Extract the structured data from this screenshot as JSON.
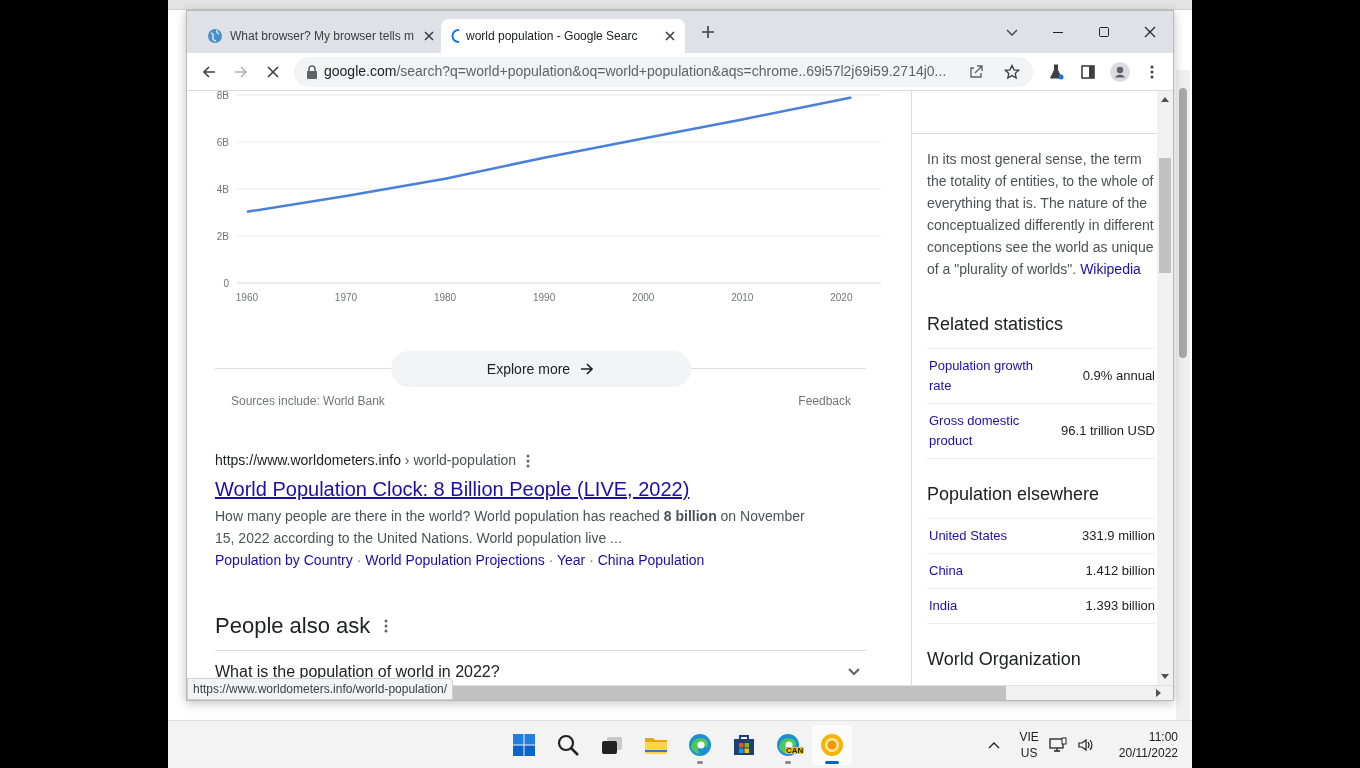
{
  "browser": {
    "tabs": [
      {
        "title": "What browser? My browser tells m",
        "selected": false,
        "loading": false
      },
      {
        "title": "world population - Google Searc",
        "selected": true,
        "loading": true
      }
    ],
    "address": {
      "host": "google.com",
      "path": "/search?q=world+population&oq=world+population&aqs=chrome..69i57l2j69i59.2714j0..."
    }
  },
  "chart": {
    "chart_data": {
      "type": "line",
      "x": [
        1960,
        1970,
        1980,
        1990,
        2000,
        2010,
        2021
      ],
      "series": [
        {
          "color": "#4a7fdb",
          "values": [
            3.03,
            3.7,
            4.44,
            5.33,
            6.15,
            6.96,
            7.89
          ]
        }
      ],
      "xlim": [
        1959,
        2024
      ],
      "ylim": [
        0,
        8
      ],
      "grid": true,
      "xticks": [
        1960,
        1970,
        1980,
        1990,
        2000,
        2010,
        2020
      ],
      "yticks": [
        {
          "value": 0,
          "label": "0"
        },
        {
          "value": 2,
          "label": "2B"
        },
        {
          "value": 4,
          "label": "4B"
        },
        {
          "value": 6,
          "label": "6B"
        },
        {
          "value": 8,
          "label": "8B"
        }
      ]
    }
  },
  "explore_button": "Explore more",
  "sources": "Sources include: World Bank",
  "feedback": "Feedback",
  "result": {
    "site": "https://www.worldometers.info",
    "path": "› world-population",
    "title": "World Population Clock: 8 Billion People (LIVE, 2022)",
    "snippet": "How many people are there in the world? World population has reached **8 billion** on November 15, 2022 according to the United Nations. World population live ...",
    "separator": "·",
    "sitelinks": [
      "Population by Country",
      "World Population Projections",
      "Year",
      "China Population"
    ]
  },
  "people_also_ask": {
    "heading": "People also ask",
    "questions": [
      {
        "text": "What is the population of world in 2022?",
        "expanded": false
      }
    ]
  },
  "side_panel": {
    "description_lines": [
      "In its most general sense, the term",
      "the totality of entities, to the whole of",
      "everything that is. The nature of the",
      "conceptualized differently in different",
      "conceptions see the world as unique",
      "of a \"plurality of worlds\"."
    ],
    "source_link": "Wikipedia",
    "related_statistics": {
      "heading": "Related statistics",
      "rows": [
        {
          "label": "Population growth rate",
          "value_lines": [
            "0.9% annual"
          ]
        },
        {
          "label": "Gross domestic product",
          "value_lines": [
            "96.1 trillion USD"
          ]
        }
      ]
    },
    "population_elsewhere": {
      "heading": "Population elsewhere",
      "rows": [
        {
          "label": "United States",
          "value_lines": [
            "331.9 million"
          ]
        },
        {
          "label": "China",
          "value_lines": [
            "1.412 billion"
          ]
        },
        {
          "label": "India",
          "value_lines": [
            "1.393 billion"
          ]
        }
      ]
    },
    "next_heading": "World Organization"
  },
  "status_url": "https://www.worldometers.info/world-population/",
  "taskbar": {
    "apps": [
      {
        "kind": "start",
        "selected": false,
        "running": false
      },
      {
        "kind": "search",
        "selected": false,
        "running": false
      },
      {
        "kind": "taskview",
        "selected": false,
        "running": false
      },
      {
        "kind": "explorer",
        "selected": false,
        "running": false
      },
      {
        "kind": "edge",
        "selected": false,
        "running": true
      },
      {
        "kind": "store",
        "selected": false,
        "running": false
      },
      {
        "kind": "edge-canary",
        "badge": "CAN",
        "selected": false,
        "running": true
      },
      {
        "kind": "chrome-canary",
        "selected": true,
        "running": true
      }
    ],
    "language": "VIE",
    "region": "US",
    "time": "11:00",
    "date": "20/11/2022"
  }
}
